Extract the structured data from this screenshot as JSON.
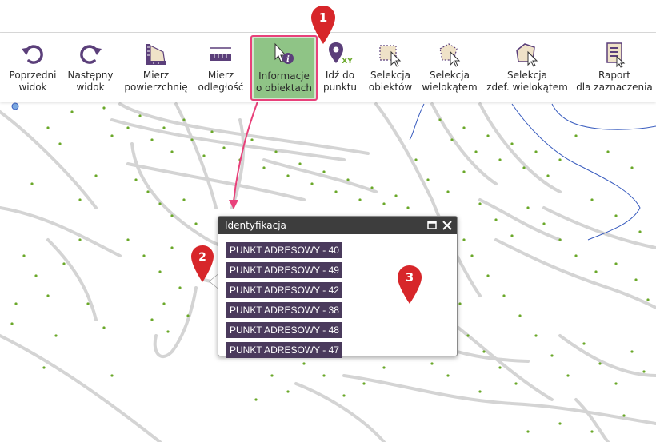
{
  "toolbar": {
    "items": [
      {
        "icon": "undo-arrow-icon",
        "line1": "Poprzedni",
        "line2": "widok"
      },
      {
        "icon": "redo-arrow-icon",
        "line1": "Następny",
        "line2": "widok"
      },
      {
        "icon": "measure-area-icon",
        "line1": "Mierz",
        "line2": "powierzchnię"
      },
      {
        "icon": "ruler-icon",
        "line1": "Mierz",
        "line2": "odległość"
      },
      {
        "icon": "info-cursor-icon",
        "line1": "Informacje",
        "line2": "o obiektach",
        "active": true
      },
      {
        "icon": "map-pin-xy-icon",
        "line1": "Idź do",
        "line2": "punktu"
      },
      {
        "icon": "select-objects-icon",
        "line1": "Selekcja",
        "line2": "obiektów"
      },
      {
        "icon": "select-polygon-icon",
        "line1": "Selekcja",
        "line2": "wielokątem"
      },
      {
        "icon": "select-defined-polygon-icon",
        "line1": "Selekcja",
        "line2": "zdef. wielokątem"
      },
      {
        "icon": "report-icon",
        "line1": "Raport",
        "line2": "dla zaznaczenia"
      }
    ],
    "xy_label": "XY"
  },
  "popup": {
    "title": "Identyfikacja",
    "rows": [
      "PUNKT ADRESOWY - 40",
      "PUNKT ADRESOWY - 49",
      "PUNKT ADRESOWY - 42",
      "PUNKT ADRESOWY - 38",
      "PUNKT ADRESOWY - 48",
      "PUNKT ADRESOWY - 47"
    ]
  },
  "markers": {
    "m1": "1",
    "m2": "2",
    "m3": "3"
  },
  "colors": {
    "accent_purple": "#5b3f7a",
    "active_green": "#8fc486",
    "highlight_pink": "#e8417a",
    "marker_red": "#d7262a",
    "point_green": "#6aa82a",
    "road_gray": "#d6d6d6",
    "water_blue": "#3a5dbf"
  }
}
